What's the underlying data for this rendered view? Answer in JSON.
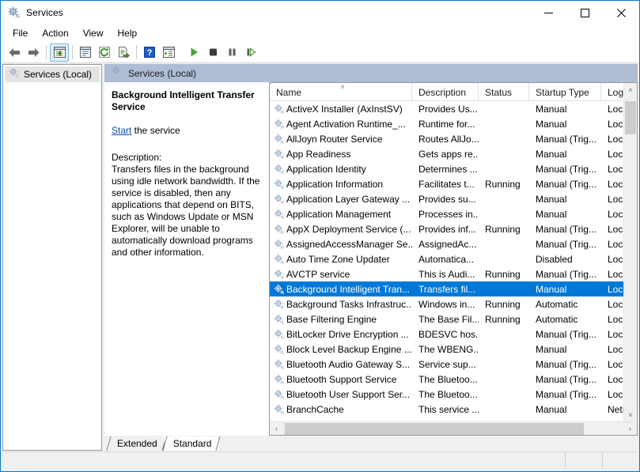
{
  "window": {
    "title": "Services",
    "icon": "services-gear-icon",
    "minimize_label": "─",
    "maximize_label": "□",
    "close_label": "✕"
  },
  "menubar": {
    "items": [
      {
        "label": "File"
      },
      {
        "label": "Action"
      },
      {
        "label": "View"
      },
      {
        "label": "Help"
      }
    ]
  },
  "toolbar": {
    "buttons": [
      {
        "name": "back-arrow-icon",
        "title": "Back"
      },
      {
        "name": "forward-arrow-icon",
        "title": "Forward"
      },
      {
        "name": "show-hide-console-tree-icon",
        "title": "Show/Hide Console Tree"
      },
      {
        "name": "properties-icon",
        "title": "Properties"
      },
      {
        "name": "refresh-icon",
        "title": "Refresh"
      },
      {
        "name": "export-list-icon",
        "title": "Export List"
      },
      {
        "name": "help-icon",
        "title": "Help"
      },
      {
        "name": "show-action-pane-icon",
        "title": "Show/Hide Action Pane"
      },
      {
        "name": "start-service-icon",
        "title": "Start Service"
      },
      {
        "name": "stop-service-icon",
        "title": "Stop Service"
      },
      {
        "name": "pause-service-icon",
        "title": "Pause Service"
      },
      {
        "name": "restart-service-icon",
        "title": "Restart Service"
      }
    ]
  },
  "tree": {
    "root_label": "Services (Local)"
  },
  "banner": {
    "label": "Services (Local)"
  },
  "detail": {
    "title": "Background Intelligent Transfer Service",
    "action_link": "Start",
    "action_suffix": " the service",
    "description_label": "Description:",
    "description": "Transfers files in the background using idle network bandwidth. If the service is disabled, then any applications that depend on BITS, such as Windows Update or MSN Explorer, will be unable to automatically download programs and other information."
  },
  "list": {
    "columns": [
      {
        "key": "name",
        "label": "Name",
        "sorted": true,
        "sort_caret": "˄"
      },
      {
        "key": "description",
        "label": "Description",
        "sorted": false
      },
      {
        "key": "status",
        "label": "Status",
        "sorted": false
      },
      {
        "key": "startup",
        "label": "Startup Type",
        "sorted": false
      },
      {
        "key": "logon",
        "label": "Log",
        "sorted": false
      }
    ],
    "rows": [
      {
        "name": "ActiveX Installer (AxInstSV)",
        "description": "Provides Us...",
        "status": "",
        "startup": "Manual",
        "logon": "Locı",
        "selected": false
      },
      {
        "name": "Agent Activation Runtime_...",
        "description": "Runtime for...",
        "status": "",
        "startup": "Manual",
        "logon": "Locı",
        "selected": false
      },
      {
        "name": "AllJoyn Router Service",
        "description": "Routes AllJo...",
        "status": "",
        "startup": "Manual (Trig...",
        "logon": "Locı",
        "selected": false
      },
      {
        "name": "App Readiness",
        "description": "Gets apps re...",
        "status": "",
        "startup": "Manual",
        "logon": "Locı",
        "selected": false
      },
      {
        "name": "Application Identity",
        "description": "Determines ...",
        "status": "",
        "startup": "Manual (Trig...",
        "logon": "Locı",
        "selected": false
      },
      {
        "name": "Application Information",
        "description": "Facilitates t...",
        "status": "Running",
        "startup": "Manual (Trig...",
        "logon": "Locı",
        "selected": false
      },
      {
        "name": "Application Layer Gateway ...",
        "description": "Provides su...",
        "status": "",
        "startup": "Manual",
        "logon": "Locı",
        "selected": false
      },
      {
        "name": "Application Management",
        "description": "Processes in...",
        "status": "",
        "startup": "Manual",
        "logon": "Locı",
        "selected": false
      },
      {
        "name": "AppX Deployment Service (...",
        "description": "Provides inf...",
        "status": "Running",
        "startup": "Manual (Trig...",
        "logon": "Locı",
        "selected": false
      },
      {
        "name": "AssignedAccessManager Se...",
        "description": "AssignedAc...",
        "status": "",
        "startup": "Manual (Trig...",
        "logon": "Locı",
        "selected": false
      },
      {
        "name": "Auto Time Zone Updater",
        "description": "Automatica...",
        "status": "",
        "startup": "Disabled",
        "logon": "Locı",
        "selected": false
      },
      {
        "name": "AVCTP service",
        "description": "This is Audi...",
        "status": "Running",
        "startup": "Manual (Trig...",
        "logon": "Locı",
        "selected": false
      },
      {
        "name": "Background Intelligent Tran...",
        "description": "Transfers fil...",
        "status": "",
        "startup": "Manual",
        "logon": "Locı",
        "selected": true
      },
      {
        "name": "Background Tasks Infrastruc...",
        "description": "Windows in...",
        "status": "Running",
        "startup": "Automatic",
        "logon": "Locı",
        "selected": false
      },
      {
        "name": "Base Filtering Engine",
        "description": "The Base Fil...",
        "status": "Running",
        "startup": "Automatic",
        "logon": "Locı",
        "selected": false
      },
      {
        "name": "BitLocker Drive Encryption ...",
        "description": "BDESVC hos...",
        "status": "",
        "startup": "Manual (Trig...",
        "logon": "Locı",
        "selected": false
      },
      {
        "name": "Block Level Backup Engine ...",
        "description": "The WBENG...",
        "status": "",
        "startup": "Manual",
        "logon": "Locı",
        "selected": false
      },
      {
        "name": "Bluetooth Audio Gateway S...",
        "description": "Service sup...",
        "status": "",
        "startup": "Manual (Trig...",
        "logon": "Locı",
        "selected": false
      },
      {
        "name": "Bluetooth Support Service",
        "description": "The Bluetoo...",
        "status": "",
        "startup": "Manual (Trig...",
        "logon": "Locı",
        "selected": false
      },
      {
        "name": "Bluetooth User Support Ser...",
        "description": "The Bluetoo...",
        "status": "",
        "startup": "Manual (Trig...",
        "logon": "Locı",
        "selected": false
      },
      {
        "name": "BranchCache",
        "description": "This service ...",
        "status": "",
        "startup": "Manual",
        "logon": "Netı",
        "selected": false
      }
    ],
    "scroll": {
      "up_arrow": "˄",
      "down_arrow": "˅",
      "left_arrow": "‹",
      "right_arrow": "›"
    }
  },
  "tabs": [
    {
      "label": "Extended",
      "active": false
    },
    {
      "label": "Standard",
      "active": true
    }
  ],
  "statusbar": {
    "pane1": "",
    "pane2": "",
    "pane3": ""
  },
  "colors": {
    "accent": "#0078d7",
    "banner": "#aebdd4",
    "selection": "#0078d7",
    "link": "#0b4fb3",
    "window_border": "#0078d7"
  }
}
